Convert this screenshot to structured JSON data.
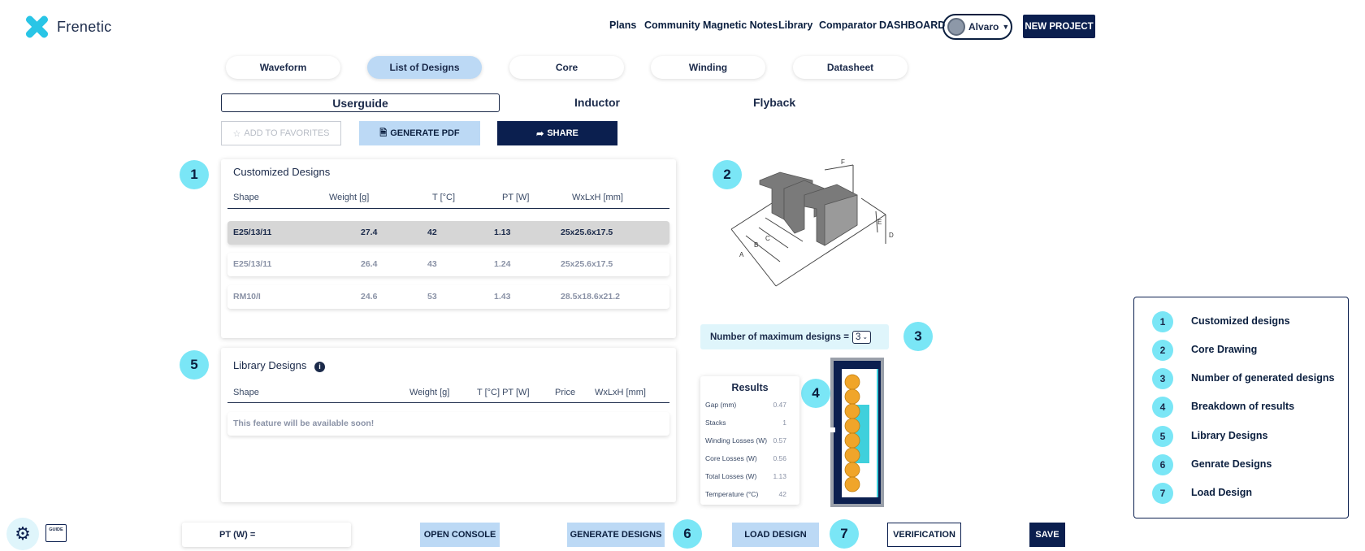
{
  "header": {
    "brand": "Frenetic",
    "nav": [
      "Plans",
      "Community",
      "Magnetic Notes",
      "Library",
      "Comparator",
      "DASHBOARD"
    ],
    "user": "Alvaro",
    "new_project": "NEW PROJECT"
  },
  "tabs": [
    "Waveform",
    "List of Designs",
    "Core",
    "Winding",
    "Datasheet"
  ],
  "active_tab": "List of Designs",
  "subtabs": [
    "Userguide",
    "Inductor",
    "Flyback"
  ],
  "actions": {
    "favorites": "ADD TO FAVORITES",
    "pdf": "GENERATE PDF",
    "share": "SHARE"
  },
  "badges": [
    "1",
    "2",
    "3",
    "4",
    "5",
    "6",
    "7"
  ],
  "customized": {
    "title": "Customized Designs",
    "columns": [
      "Shape",
      "Weight [g]",
      "T [°C]",
      "PT [W]",
      "WxLxH [mm]"
    ],
    "rows": [
      [
        "E25/13/11",
        "27.4",
        "42",
        "1.13",
        "25x25.6x17.5"
      ],
      [
        "E25/13/11",
        "26.4",
        "43",
        "1.24",
        "25x25.6x17.5"
      ],
      [
        "RM10/I",
        "24.6",
        "53",
        "1.43",
        "28.5x18.6x21.2"
      ]
    ]
  },
  "library": {
    "title": "Library Designs",
    "columns": [
      "Shape",
      "Weight [g]",
      "T [°C] PT [W]",
      "Price",
      "WxLxH [mm]"
    ],
    "empty": "This feature will be available soon!"
  },
  "core_drawing_labels": [
    "F",
    "E",
    "D",
    "A",
    "B",
    "C"
  ],
  "max_designs": {
    "label": "Number of maximum designs =",
    "value": "3"
  },
  "results": {
    "title": "Results",
    "items": [
      {
        "label": "Gap (mm)",
        "value": "0.47"
      },
      {
        "label": "Stacks",
        "value": "1"
      },
      {
        "label": "Winding Losses (W)",
        "value": "0.57"
      },
      {
        "label": "Core Losses (W)",
        "value": "0.56"
      },
      {
        "label": "Total Losses (W)",
        "value": "1.13"
      },
      {
        "label": "Temperature (°C)",
        "value": "42"
      }
    ]
  },
  "legend": [
    {
      "num": "1",
      "text": "Customized designs"
    },
    {
      "num": "2",
      "text": "Core Drawing"
    },
    {
      "num": "3",
      "text": "Number of generated designs"
    },
    {
      "num": "4",
      "text": "Breakdown of results"
    },
    {
      "num": "5",
      "text": "Library Designs"
    },
    {
      "num": "6",
      "text": "Genrate Designs"
    },
    {
      "num": "7",
      "text": "Load Design"
    }
  ],
  "footer": {
    "pt_label": "PT (W) =",
    "open_console": "OPEN CONSOLE",
    "generate": "GENERATE DESIGNS",
    "load": "LOAD DESIGN",
    "verification": "VERIFICATION",
    "save": "SAVE",
    "guide": "GUIDE"
  },
  "colors": {
    "navy": "#0b1f4f",
    "accent": "#7ae6f6",
    "light_blue": "#bcd9f5"
  }
}
